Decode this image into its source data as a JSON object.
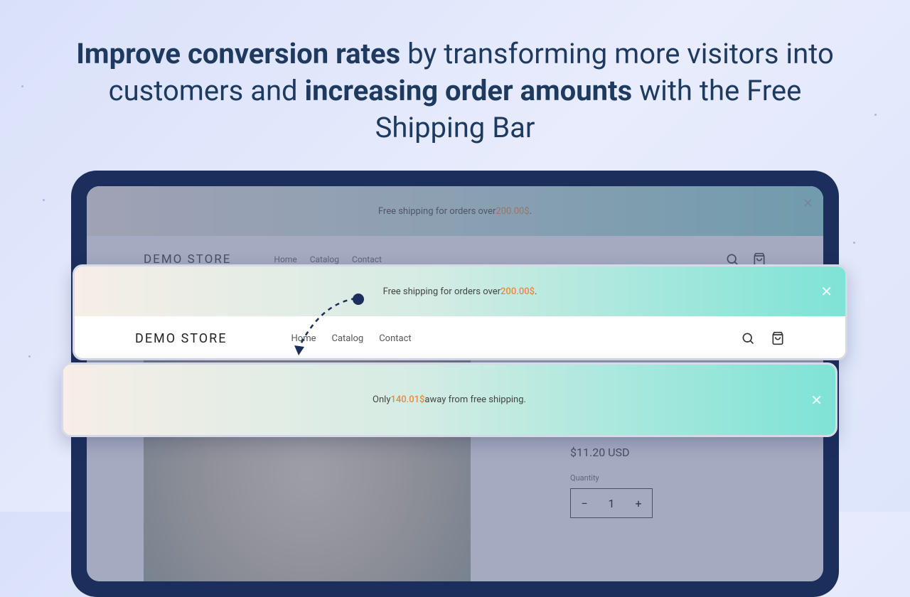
{
  "headline": {
    "b1": "Improve conversion rates",
    "t1": " by transforming more visitors into customers and ",
    "b2": "increasing order amounts",
    "t2": " with the Free Shipping Bar"
  },
  "bg_bar": {
    "prefix": "Free shipping for orders over ",
    "amount": "200.00$",
    "suffix": "."
  },
  "store": {
    "logo": "DEMO STORE",
    "nav": {
      "home": "Home",
      "catalog": "Catalog",
      "contact": "Contact"
    }
  },
  "product": {
    "price": "$11.20 USD",
    "qty_label": "Quantity",
    "qty_value": "1"
  },
  "float_top": {
    "prefix": "Free shipping for orders over ",
    "amount": "200.00$",
    "suffix": "."
  },
  "float_bottom": {
    "prefix": "Only ",
    "amount": "140.01$",
    "suffix": " away from free shipping."
  }
}
